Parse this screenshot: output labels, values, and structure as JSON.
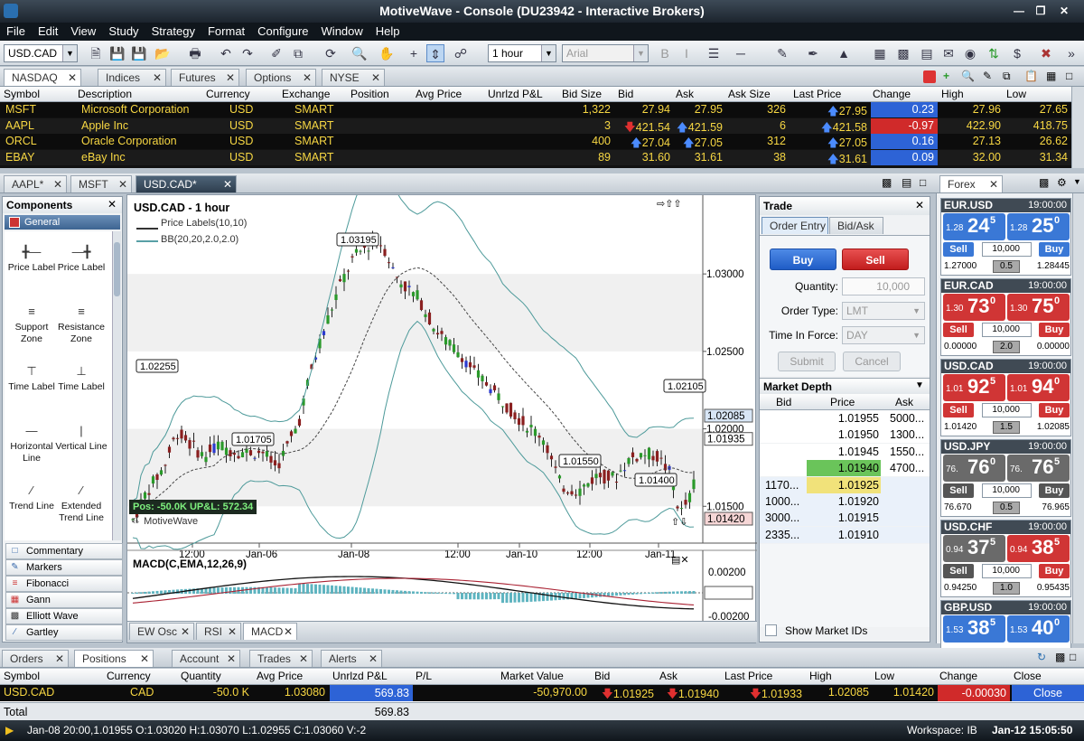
{
  "window": {
    "title": "MotiveWave - Console (DU23942 - Interactive Brokers)"
  },
  "menu": [
    "File",
    "Edit",
    "View",
    "Study",
    "Strategy",
    "Format",
    "Configure",
    "Window",
    "Help"
  ],
  "toolbar": {
    "symbol": "USD.CAD",
    "interval": "1 hour",
    "font": "Arial"
  },
  "watch_tabs": [
    "NASDAQ",
    "Indices",
    "Futures",
    "Options",
    "NYSE"
  ],
  "watch_columns": [
    "Symbol",
    "Description",
    "Currency",
    "Exchange",
    "Position",
    "Avg Price",
    "Unrlzd P&L",
    "Bid Size",
    "Bid",
    "Ask",
    "Ask Size",
    "Last Price",
    "Change",
    "High",
    "Low"
  ],
  "watch_rows": [
    {
      "symbol": "MSFT",
      "desc": "Microsoft Corporation",
      "cur": "USD",
      "exch": "SMART",
      "bid_size": "1,322",
      "bid": "27.94",
      "ask": "27.95",
      "ask_size": "326",
      "last": "27.95",
      "change": "0.23",
      "high": "27.96",
      "low": "27.65",
      "change_color": "#2d63d6",
      "bid_dir": "",
      "ask_dir": "",
      "last_dir": "up"
    },
    {
      "symbol": "AAPL",
      "desc": "Apple Inc",
      "cur": "USD",
      "exch": "SMART",
      "bid_size": "3",
      "bid": "421.54",
      "ask": "421.59",
      "ask_size": "6",
      "last": "421.58",
      "change": "-0.97",
      "high": "422.90",
      "low": "418.75",
      "change_color": "#d02a2a",
      "bid_dir": "down",
      "ask_dir": "up",
      "last_dir": "up"
    },
    {
      "symbol": "ORCL",
      "desc": "Oracle Corporation",
      "cur": "USD",
      "exch": "SMART",
      "bid_size": "400",
      "bid": "27.04",
      "ask": "27.05",
      "ask_size": "312",
      "last": "27.05",
      "change": "0.16",
      "high": "27.13",
      "low": "26.62",
      "change_color": "#2d63d6",
      "bid_dir": "up",
      "ask_dir": "up",
      "last_dir": "up"
    },
    {
      "symbol": "EBAY",
      "desc": "eBay Inc",
      "cur": "USD",
      "exch": "SMART",
      "bid_size": "89",
      "bid": "31.60",
      "ask": "31.61",
      "ask_size": "38",
      "last": "31.61",
      "change": "0.09",
      "high": "32.00",
      "low": "31.34",
      "change_color": "#2d63d6",
      "bid_dir": "",
      "ask_dir": "",
      "last_dir": "up"
    }
  ],
  "chart_tabs": [
    "AAPL*",
    "MSFT",
    "USD.CAD*"
  ],
  "components": {
    "title": "Components",
    "general": "General",
    "items": [
      "Price Label",
      "Price Label",
      "Support Zone",
      "Resistance Zone",
      "Time Label",
      "Time Label",
      "Horizontal Line",
      "Vertical Line",
      "Trend Line",
      "Extended Trend Line"
    ],
    "categories": [
      "Commentary",
      "Markers",
      "Fibonacci",
      "Gann",
      "Elliott Wave",
      "Gartley"
    ]
  },
  "chart": {
    "title": "USD.CAD - 1 hour",
    "legend1": "Price Labels(10,10)",
    "legend2": "BB(20,20,2.0,2.0)",
    "position_label": "Pos: -50.0K UP&L: 572.34",
    "watermark": "MotiveWave",
    "price_labels": [
      "1.03195",
      "1.02255",
      "1.01705",
      "1.01550",
      "1.01400",
      "1.02105"
    ],
    "y_ticks": [
      "1.03000",
      "1.02500",
      "1.02000",
      "1.01500"
    ],
    "price_markers": [
      "1.02085",
      "1.01935",
      "1.01420"
    ],
    "x_ticks": [
      "12:00",
      "Jan-06",
      "Jan-08",
      "12:00",
      "Jan-10",
      "12:00",
      "Jan-11"
    ],
    "macd_title": "MACD(C,EMA,12,26,9)",
    "macd_ticks": [
      "0.00200",
      "0.00011",
      "-0.00200"
    ],
    "indicator_tabs": [
      "EW Osc",
      "RSI",
      "MACD"
    ]
  },
  "chart_data": {
    "type": "candlestick",
    "title": "USD.CAD - 1 hour",
    "x": [
      "12:00",
      "Jan-06",
      "Jan-08",
      "12:00",
      "Jan-10",
      "12:00",
      "Jan-11"
    ],
    "ylim": [
      1.0135,
      1.0345
    ],
    "price_labels": [
      1.03195,
      1.02255,
      1.01705,
      1.0155,
      1.014,
      1.02105
    ],
    "last_price": 1.01935
  },
  "trade": {
    "title": "Trade",
    "tabs": [
      "Order Entry",
      "Bid/Ask"
    ],
    "buy": "Buy",
    "sell": "Sell",
    "quantity_label": "Quantity:",
    "quantity": "10,000",
    "order_type_label": "Order Type:",
    "order_type": "LMT",
    "tif_label": "Time In Force:",
    "tif": "DAY",
    "submit": "Submit",
    "cancel": "Cancel",
    "depth_title": "Market Depth",
    "depth_cols": [
      "Bid",
      "Price",
      "Ask"
    ],
    "depth": [
      {
        "bid": "",
        "price": "1.01955",
        "ask": "5000..."
      },
      {
        "bid": "",
        "price": "1.01950",
        "ask": "1300..."
      },
      {
        "bid": "",
        "price": "1.01945",
        "ask": "1550..."
      },
      {
        "bid": "",
        "price": "1.01940",
        "ask": "4700..."
      },
      {
        "bid": "1170...",
        "price": "1.01925",
        "ask": ""
      },
      {
        "bid": "1000...",
        "price": "1.01920",
        "ask": ""
      },
      {
        "bid": "3000...",
        "price": "1.01915",
        "ask": ""
      },
      {
        "bid": "2335...",
        "price": "1.01910",
        "ask": ""
      }
    ],
    "show_ids": "Show Market IDs"
  },
  "forex": {
    "tab": "Forex",
    "pairs": [
      {
        "pair": "EUR.USD",
        "time": "19:00:00",
        "bid_small": "1.28",
        "bid_big": "24",
        "bid_sup": "5",
        "ask_small": "1.28",
        "ask_big": "25",
        "ask_sup": "0",
        "qty": "10,000",
        "low": "1.27000",
        "spread": "0.5",
        "high": "1.28445",
        "color": "#3a78d6",
        "bid_color": "#3a78d6"
      },
      {
        "pair": "EUR.CAD",
        "time": "19:00:00",
        "bid_small": "1.30",
        "bid_big": "73",
        "bid_sup": "0",
        "ask_small": "1.30",
        "ask_big": "75",
        "ask_sup": "0",
        "qty": "10,000",
        "low": "0.00000",
        "spread": "2.0",
        "high": "0.00000",
        "color": "#d03535",
        "bid_color": "#d03535"
      },
      {
        "pair": "USD.CAD",
        "time": "19:00:00",
        "bid_small": "1.01",
        "bid_big": "92",
        "bid_sup": "5",
        "ask_small": "1.01",
        "ask_big": "94",
        "ask_sup": "0",
        "qty": "10,000",
        "low": "1.01420",
        "spread": "1.5",
        "high": "1.02085",
        "color": "#d03535",
        "bid_color": "#d03535"
      },
      {
        "pair": "USD.JPY",
        "time": "19:00:00",
        "bid_small": "76.",
        "bid_big": "76",
        "bid_sup": "0",
        "ask_small": "76.",
        "ask_big": "76",
        "ask_sup": "5",
        "qty": "10,000",
        "low": "76.670",
        "spread": "0.5",
        "high": "76.965",
        "color": "#6a6a6a",
        "bid_color": "#6a6a6a"
      },
      {
        "pair": "USD.CHF",
        "time": "19:00:00",
        "bid_small": "0.94",
        "bid_big": "37",
        "bid_sup": "5",
        "ask_small": "0.94",
        "ask_big": "38",
        "ask_sup": "5",
        "qty": "10,000",
        "low": "0.94250",
        "spread": "1.0",
        "high": "0.95435",
        "color": "#d03535",
        "bid_color": "#6a6a6a"
      },
      {
        "pair": "GBP.USD",
        "time": "19:00:00",
        "bid_small": "1.53",
        "bid_big": "38",
        "bid_sup": "5",
        "ask_small": "1.53",
        "ask_big": "40",
        "ask_sup": "0",
        "qty": "",
        "low": "",
        "spread": "",
        "high": "",
        "color": "#3a78d6",
        "bid_color": "#3a78d6"
      }
    ]
  },
  "positions": {
    "tabs": [
      "Orders",
      "Positions",
      "Account",
      "Trades",
      "Alerts"
    ],
    "columns": [
      "Symbol",
      "Currency",
      "Quantity",
      "Avg Price",
      "Unrlzd P&L",
      "P/L",
      "Market Value",
      "Bid",
      "Ask",
      "Last Price",
      "High",
      "Low",
      "Change",
      "Close"
    ],
    "row": {
      "symbol": "USD.CAD",
      "cur": "CAD",
      "qty": "-50.0 K",
      "avg": "1.03080",
      "upl": "569.83",
      "mv": "-50,970.00",
      "bid": "1.01925",
      "ask": "1.01940",
      "last": "1.01933",
      "high": "1.02085",
      "low": "1.01420",
      "change": "-0.00030",
      "close": "Close"
    },
    "total_label": "Total",
    "total": "569.83"
  },
  "status": {
    "ohlc": "Jan-08 20:00,1.01955 O:1.03020 H:1.03070 L:1.02955 C:1.03060 V:-2",
    "workspace": "Workspace: IB",
    "clock": "Jan-12 15:05:50"
  }
}
